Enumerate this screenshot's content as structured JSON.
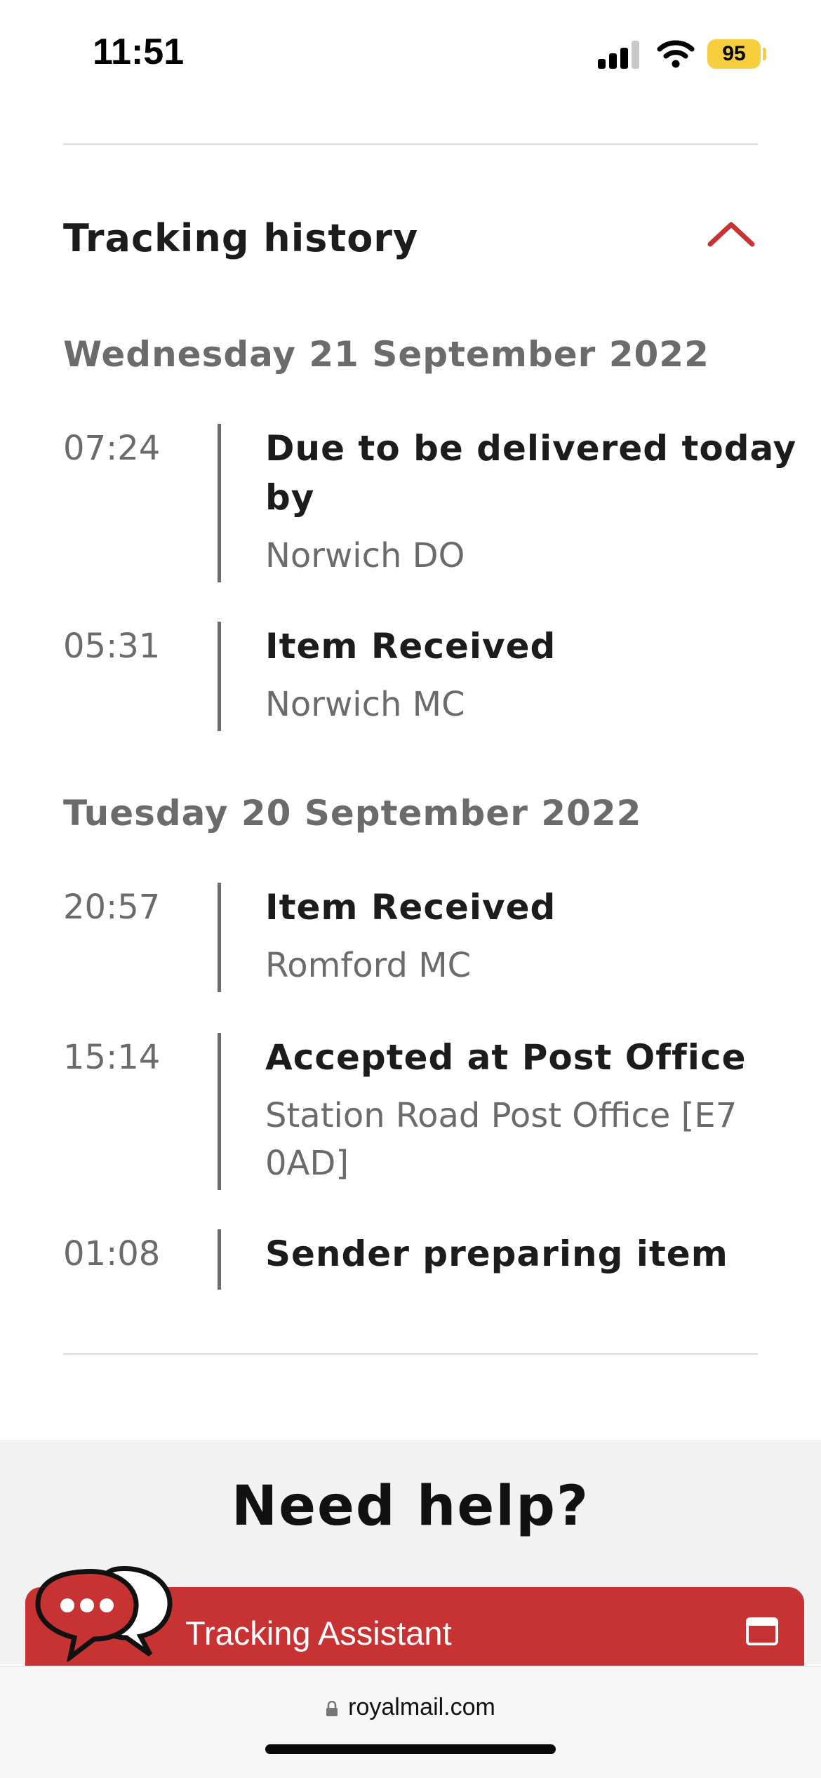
{
  "status_bar": {
    "time": "11:51",
    "battery": "95"
  },
  "tracking": {
    "title": "Tracking history",
    "days": [
      {
        "date": "Wednesday 21 September 2022",
        "events": [
          {
            "time": "07:24",
            "status": "Due to be delivered today by",
            "location": "Norwich DO"
          },
          {
            "time": "05:31",
            "status": "Item Received",
            "location": "Norwich MC"
          }
        ]
      },
      {
        "date": "Tuesday 20 September 2022",
        "events": [
          {
            "time": "20:57",
            "status": "Item Received",
            "location": "Romford MC"
          },
          {
            "time": "15:14",
            "status": "Accepted at Post Office",
            "location": "Station Road Post Office [E7 0AD]"
          },
          {
            "time": "01:08",
            "status": "Sender preparing item",
            "location": ""
          }
        ]
      }
    ]
  },
  "help": {
    "title": "Need help?"
  },
  "assistant": {
    "label": "Tracking Assistant"
  },
  "browser": {
    "url": "royalmail.com"
  },
  "colors": {
    "accent": "#c73333",
    "muted_text": "#6b6b6b",
    "battery": "#f7cf3e"
  },
  "icons": [
    "signal-icon",
    "wifi-icon",
    "chevron-up-icon",
    "chat-bubbles-icon",
    "window-icon",
    "lock-icon"
  ]
}
